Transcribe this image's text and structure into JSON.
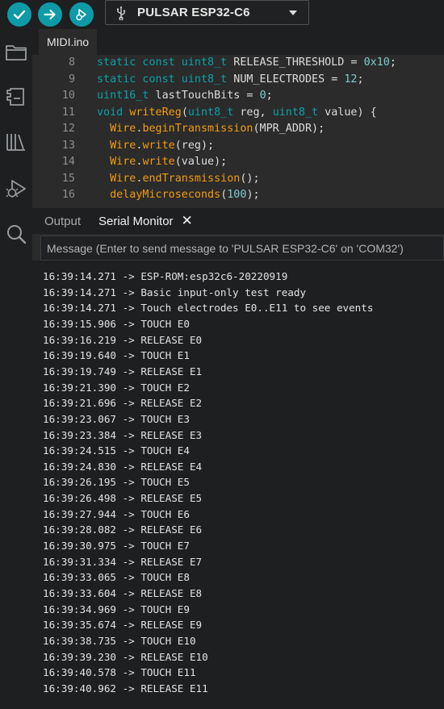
{
  "toolbar": {
    "verify_icon": "check-icon",
    "upload_icon": "arrow-right-icon",
    "debug_icon": "debugger-icon",
    "board_icon": "usb-icon",
    "board_name": "PULSAR ESP32-C6",
    "accent_color": "#0e9aa7"
  },
  "sidebar": {
    "items": [
      "folder-icon",
      "board-manager-icon",
      "library-icon",
      "debug-icon",
      "search-icon"
    ]
  },
  "editor": {
    "tab_label": "MIDI.ino",
    "lines": [
      {
        "n": "8",
        "tokens": [
          [
            "kw",
            "static const uint8_t"
          ],
          [
            "t",
            " RELEASE_THRESHOLD = "
          ],
          [
            "num",
            "0x10"
          ],
          [
            "t",
            ";"
          ]
        ]
      },
      {
        "n": "9",
        "tokens": [
          [
            "kw",
            "static const uint8_t"
          ],
          [
            "t",
            " NUM_ELECTRODES = "
          ],
          [
            "num",
            "12"
          ],
          [
            "t",
            ";"
          ]
        ]
      },
      {
        "n": "10",
        "tokens": [
          [
            "kw",
            "uint16_t"
          ],
          [
            "t",
            " lastTouchBits = "
          ],
          [
            "num",
            "0"
          ],
          [
            "t",
            ";"
          ]
        ]
      },
      {
        "n": "11",
        "tokens": [
          [
            "kw",
            "void"
          ],
          [
            "t",
            " "
          ],
          [
            "fn",
            "writeReg"
          ],
          [
            "t",
            "("
          ],
          [
            "kw",
            "uint8_t"
          ],
          [
            "t",
            " reg, "
          ],
          [
            "kw",
            "uint8_t"
          ],
          [
            "t",
            " value) {"
          ]
        ]
      },
      {
        "n": "12",
        "tokens": [
          [
            "t",
            "  "
          ],
          [
            "fn",
            "Wire"
          ],
          [
            "t",
            "."
          ],
          [
            "fn",
            "beginTransmission"
          ],
          [
            "t",
            "(MPR_ADDR);"
          ]
        ]
      },
      {
        "n": "13",
        "tokens": [
          [
            "t",
            "  "
          ],
          [
            "fn",
            "Wire"
          ],
          [
            "t",
            "."
          ],
          [
            "fn",
            "write"
          ],
          [
            "t",
            "(reg);"
          ]
        ]
      },
      {
        "n": "14",
        "tokens": [
          [
            "t",
            "  "
          ],
          [
            "fn",
            "Wire"
          ],
          [
            "t",
            "."
          ],
          [
            "fn",
            "write"
          ],
          [
            "t",
            "(value);"
          ]
        ]
      },
      {
        "n": "15",
        "tokens": [
          [
            "t",
            "  "
          ],
          [
            "fn",
            "Wire"
          ],
          [
            "t",
            "."
          ],
          [
            "fn",
            "endTransmission"
          ],
          [
            "t",
            "();"
          ]
        ]
      },
      {
        "n": "16",
        "tokens": [
          [
            "t",
            "  "
          ],
          [
            "fn",
            "delayMicroseconds"
          ],
          [
            "t",
            "("
          ],
          [
            "num",
            "100"
          ],
          [
            "t",
            ");"
          ]
        ]
      }
    ]
  },
  "panel": {
    "tabs": [
      "Output",
      "Serial Monitor"
    ],
    "close_icon": "close-icon",
    "message_placeholder": "Message (Enter to send message to 'PULSAR ESP32-C6' on 'COM32')",
    "log": [
      "16:39:14.271 -> ESP-ROM:esp32c6-20220919",
      "16:39:14.271 -> Basic input-only test ready",
      "16:39:14.271 -> Touch electrodes E0..E11 to see events",
      "16:39:15.906 -> TOUCH E0",
      "16:39:16.219 -> RELEASE E0",
      "16:39:19.640 -> TOUCH E1",
      "16:39:19.749 -> RELEASE E1",
      "16:39:21.390 -> TOUCH E2",
      "16:39:21.696 -> RELEASE E2",
      "16:39:23.067 -> TOUCH E3",
      "16:39:23.384 -> RELEASE E3",
      "16:39:24.515 -> TOUCH E4",
      "16:39:24.830 -> RELEASE E4",
      "16:39:26.195 -> TOUCH E5",
      "16:39:26.498 -> RELEASE E5",
      "16:39:27.944 -> TOUCH E6",
      "16:39:28.082 -> RELEASE E6",
      "16:39:30.975 -> TOUCH E7",
      "16:39:31.334 -> RELEASE E7",
      "16:39:33.065 -> TOUCH E8",
      "16:39:33.604 -> RELEASE E8",
      "16:39:34.969 -> TOUCH E9",
      "16:39:35.674 -> RELEASE E9",
      "16:39:38.735 -> TOUCH E10",
      "16:39:39.230 -> RELEASE E10",
      "16:39:40.578 -> TOUCH E11",
      "16:39:40.962 -> RELEASE E11"
    ]
  }
}
